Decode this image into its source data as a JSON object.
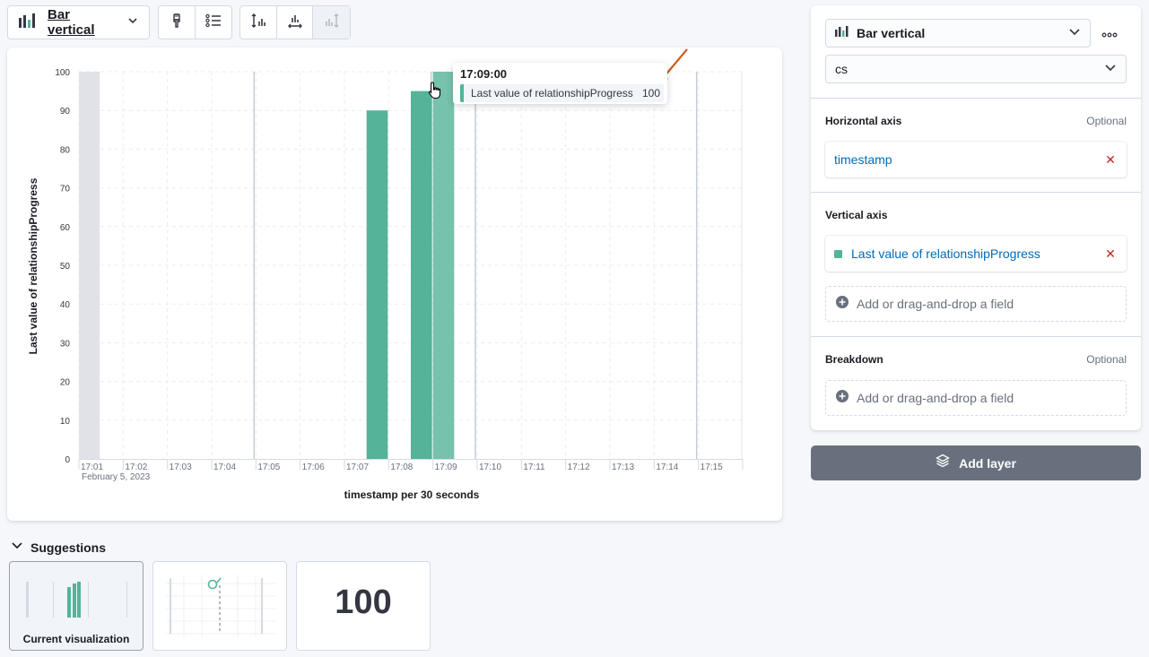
{
  "toolbar": {
    "viz_switch_label": "Bar vertical"
  },
  "tooltip": {
    "title": "17:09:00",
    "label": "Last value of relationshipProgress",
    "value": "100"
  },
  "chart_data": {
    "type": "bar",
    "ylabel": "Last value of relationshipProgress",
    "xlabel": "timestamp per 30 seconds",
    "date_label": "February 5, 2023",
    "ylim": [
      0,
      100
    ],
    "y_ticks": [
      0,
      10,
      20,
      30,
      40,
      50,
      60,
      70,
      80,
      90,
      100
    ],
    "x_ticks": [
      "17:01",
      "17:02",
      "17:03",
      "17:04",
      "17:05",
      "17:06",
      "17:07",
      "17:08",
      "17:09",
      "17:10",
      "17:11",
      "17:12",
      "17:13",
      "17:14",
      "17:15"
    ],
    "x_range_minutes": [
      "17:01",
      "17:16"
    ],
    "series": [
      {
        "name": "Last value of relationshipProgress",
        "color": "#54b399",
        "points": [
          {
            "x": "17:07:30",
            "y": 90
          },
          {
            "x": "17:08:30",
            "y": 95
          },
          {
            "x": "17:09:00",
            "y": 100
          }
        ]
      }
    ],
    "highlighted_x": "17:09:00",
    "grid": true
  },
  "suggestions": {
    "title": "Suggestions",
    "current_caption": "Current visualization",
    "metric_value": "100"
  },
  "config": {
    "chart_type": "Bar vertical",
    "index_pattern": "cs",
    "horizontal_axis": {
      "title": "Horizontal axis",
      "optional": "Optional",
      "field": "timestamp"
    },
    "vertical_axis": {
      "title": "Vertical axis",
      "field": "Last value of relationshipProgress",
      "add_field": "Add or drag-and-drop a field"
    },
    "breakdown": {
      "title": "Breakdown",
      "optional": "Optional",
      "add_field": "Add or drag-and-drop a field"
    },
    "add_layer": "Add layer"
  },
  "colors": {
    "bar": "#54b399",
    "bar_highlight": "#76c2ac",
    "link": "#006bb8",
    "remove": "#bd271e",
    "arrow": "#cc5a1f"
  }
}
